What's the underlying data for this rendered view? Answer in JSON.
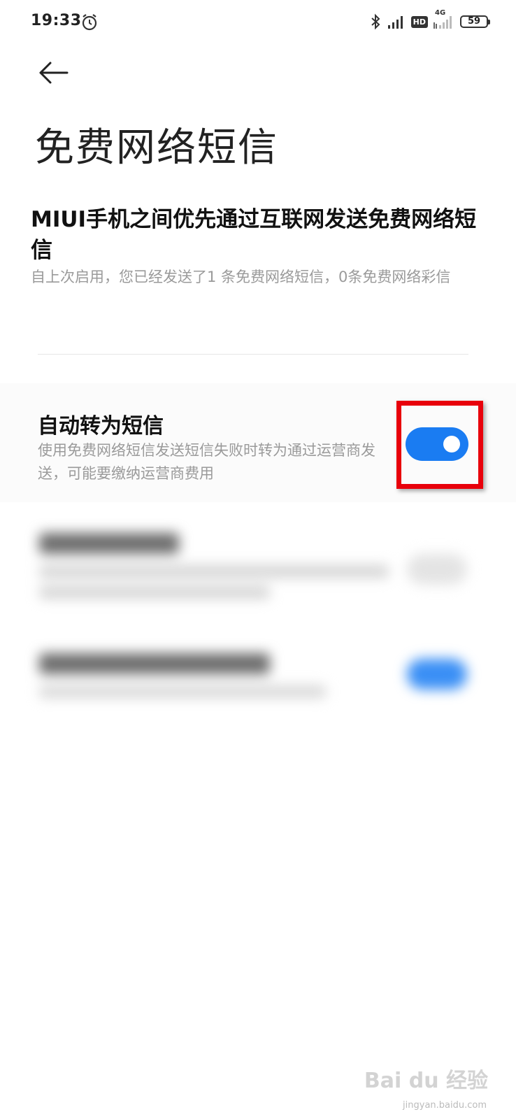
{
  "status_bar": {
    "time": "19:33",
    "icons": [
      "alarm-icon",
      "bluetooth-icon",
      "signal-icon",
      "hd-icon",
      "4g-signal-icon",
      "battery-icon"
    ],
    "hd_label": "HD",
    "net_label": "4G",
    "battery": "59"
  },
  "header": {
    "back_icon": "back-arrow-icon",
    "title": "免费网络短信"
  },
  "info": {
    "title": "MIUI手机之间优先通过互联网发送免费网络短信",
    "description": "自上次启用，您已经发送了1 条免费网络短信，0条免费网络彩信"
  },
  "settings": [
    {
      "title": "自动转为短信",
      "description": "使用免费网络短信发送短信失败时转为通过运营商发送，可能要缴纳运营商费用",
      "toggle_on": true,
      "highlighted": true
    }
  ],
  "colors": {
    "accent": "#1a7cf2",
    "highlight": "#e8000b",
    "secondary_text": "#9a9a9a"
  },
  "watermark": {
    "text": "Bai du 经验",
    "sub": "jingyan.baidu.com"
  }
}
